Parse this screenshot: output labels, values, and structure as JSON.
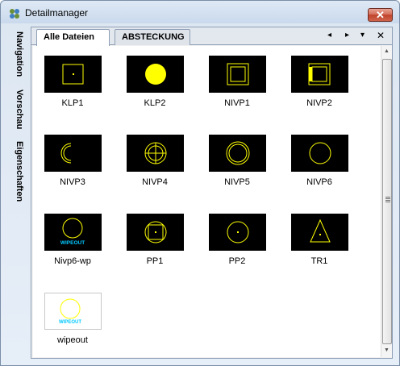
{
  "window": {
    "title": "Detailmanager",
    "close_glyph": "✕"
  },
  "vertical_tabs": [
    "Navigation",
    "Vorschau",
    "Eigenschaften"
  ],
  "tabs": {
    "items": [
      "Alle Dateien",
      "ABSTECKUNG"
    ],
    "active": 0
  },
  "tab_controls": {
    "prev": "◂",
    "next": "▸",
    "menu": "▾",
    "close": "✕"
  },
  "symbol_color": "#ffff00",
  "wipeout_color": "#00c8ff",
  "items": [
    {
      "label": "KLP1",
      "icon": "square-dot-icon"
    },
    {
      "label": "KLP2",
      "icon": "filled-circle-icon"
    },
    {
      "label": "NIVP1",
      "icon": "double-square-icon"
    },
    {
      "label": "NIVP2",
      "icon": "square-bar-icon"
    },
    {
      "label": "NIVP3",
      "icon": "arc-icon"
    },
    {
      "label": "NIVP4",
      "icon": "circle-cross-icon"
    },
    {
      "label": "NIVP5",
      "icon": "double-circle-icon"
    },
    {
      "label": "NIVP6",
      "icon": "circle-icon"
    },
    {
      "label": "Nivp6-wp",
      "icon": "circle-wipeout-icon",
      "caption": "WIPEOUT"
    },
    {
      "label": "PP1",
      "icon": "circle-square-dot-icon"
    },
    {
      "label": "PP2",
      "icon": "circle-dot-icon"
    },
    {
      "label": "TR1",
      "icon": "triangle-dot-icon"
    },
    {
      "label": "wipeout",
      "icon": "wipeout-icon",
      "caption": "WIPEOUT"
    }
  ]
}
